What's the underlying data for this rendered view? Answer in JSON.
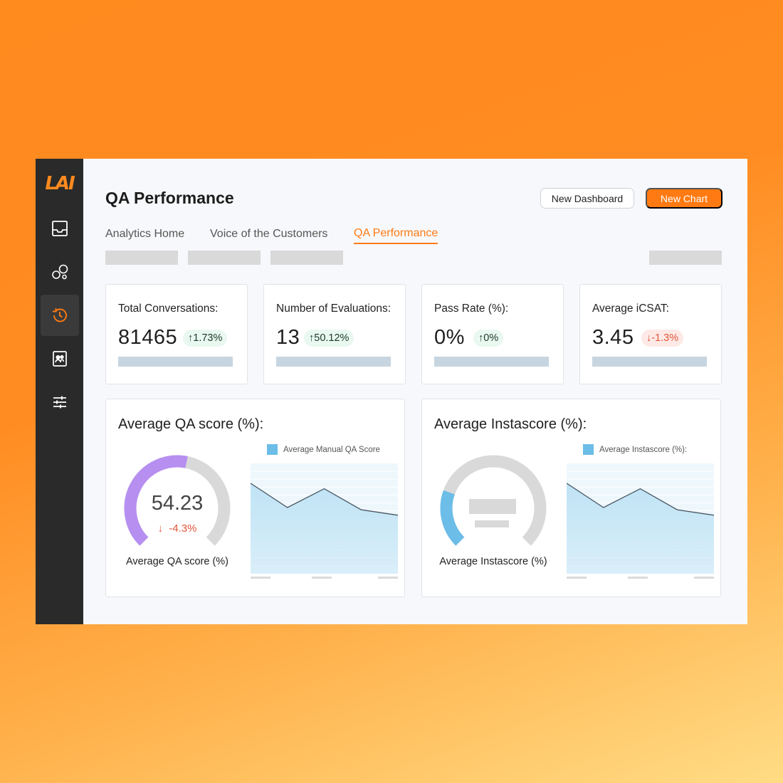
{
  "app": {
    "logo": "LAI"
  },
  "sidebar": {
    "items": [
      {
        "name": "inbox-icon"
      },
      {
        "name": "bubbles-icon"
      },
      {
        "name": "history-icon",
        "active": true
      },
      {
        "name": "contacts-icon"
      },
      {
        "name": "sliders-icon"
      }
    ]
  },
  "header": {
    "title": "QA Performance",
    "new_dashboard_label": "New Dashboard",
    "new_chart_label": "New Chart"
  },
  "tabs": [
    {
      "label": "Analytics Home"
    },
    {
      "label": "Voice of the Customers"
    },
    {
      "label": "QA Performance",
      "active": true
    }
  ],
  "kpis": [
    {
      "label": "Total Conversations:",
      "value": "81465",
      "delta": "1.73%",
      "direction": "up"
    },
    {
      "label": "Number of Evaluations:",
      "value": "13",
      "delta": "50.12%",
      "direction": "up"
    },
    {
      "label": "Pass Rate (%):",
      "value": "0%",
      "delta": "0%",
      "direction": "up"
    },
    {
      "label": "Average iCSAT:",
      "value": "3.45",
      "delta": "-1.3%",
      "direction": "down"
    }
  ],
  "panels": {
    "qa": {
      "title": "Average QA score (%):",
      "gauge_value": "54.23",
      "gauge_delta": "-4.3%",
      "gauge_caption": "Average QA score (%)",
      "gauge_fraction": 0.5423,
      "legend": "Average Manual QA Score"
    },
    "insta": {
      "title": "Average Instascore (%):",
      "gauge_caption": "Average Instascore (%)",
      "legend": "Average Instascore (%):"
    }
  },
  "chart_data": [
    {
      "type": "area",
      "series": [
        {
          "name": "Average Manual QA Score",
          "values": [
            82,
            60,
            77,
            58,
            53
          ]
        }
      ],
      "ylim": [
        0,
        100
      ]
    },
    {
      "type": "area",
      "series": [
        {
          "name": "Average Instascore (%):",
          "values": [
            82,
            60,
            77,
            58,
            53
          ]
        }
      ],
      "ylim": [
        0,
        100
      ]
    }
  ],
  "colors": {
    "accent": "#ff7a12",
    "gauge_qa": "#b68ff0",
    "gauge_insta": "#6cbde8",
    "gauge_track": "#d9d9d9",
    "area_fill": "#bfe3f5",
    "up_bg": "#e9f8f0",
    "down_text": "#e2573a"
  }
}
